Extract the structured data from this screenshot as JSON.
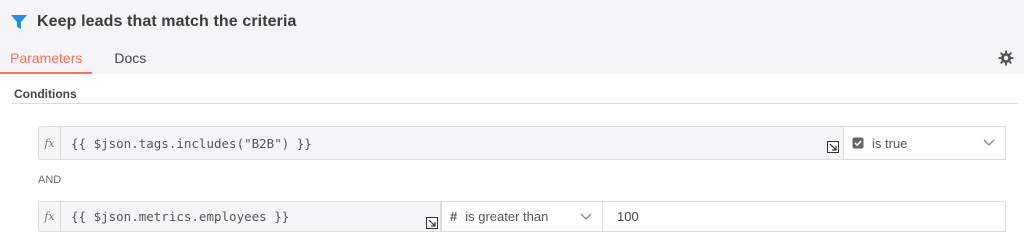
{
  "header": {
    "title": "Keep leads that match the criteria",
    "icon": "filter-icon",
    "accent_color": "#ff6d5a",
    "icon_color": "#1f8eed"
  },
  "tabs": [
    {
      "label": "Parameters",
      "active": true
    },
    {
      "label": "Docs",
      "active": false
    }
  ],
  "settings_icon": "gear-icon",
  "conditions": {
    "label": "Conditions",
    "combinator": "AND",
    "rows": [
      {
        "fx": "fx",
        "expression": "{{ $json.tags.includes(\"B2B\") }}",
        "operator_icon": "checkbox-icon",
        "operator": "is true",
        "value": ""
      },
      {
        "fx": "fx",
        "expression": "{{ $json.metrics.employees }}",
        "operator_icon": "hash-icon",
        "operator": "is greater than",
        "value": "100"
      }
    ]
  }
}
